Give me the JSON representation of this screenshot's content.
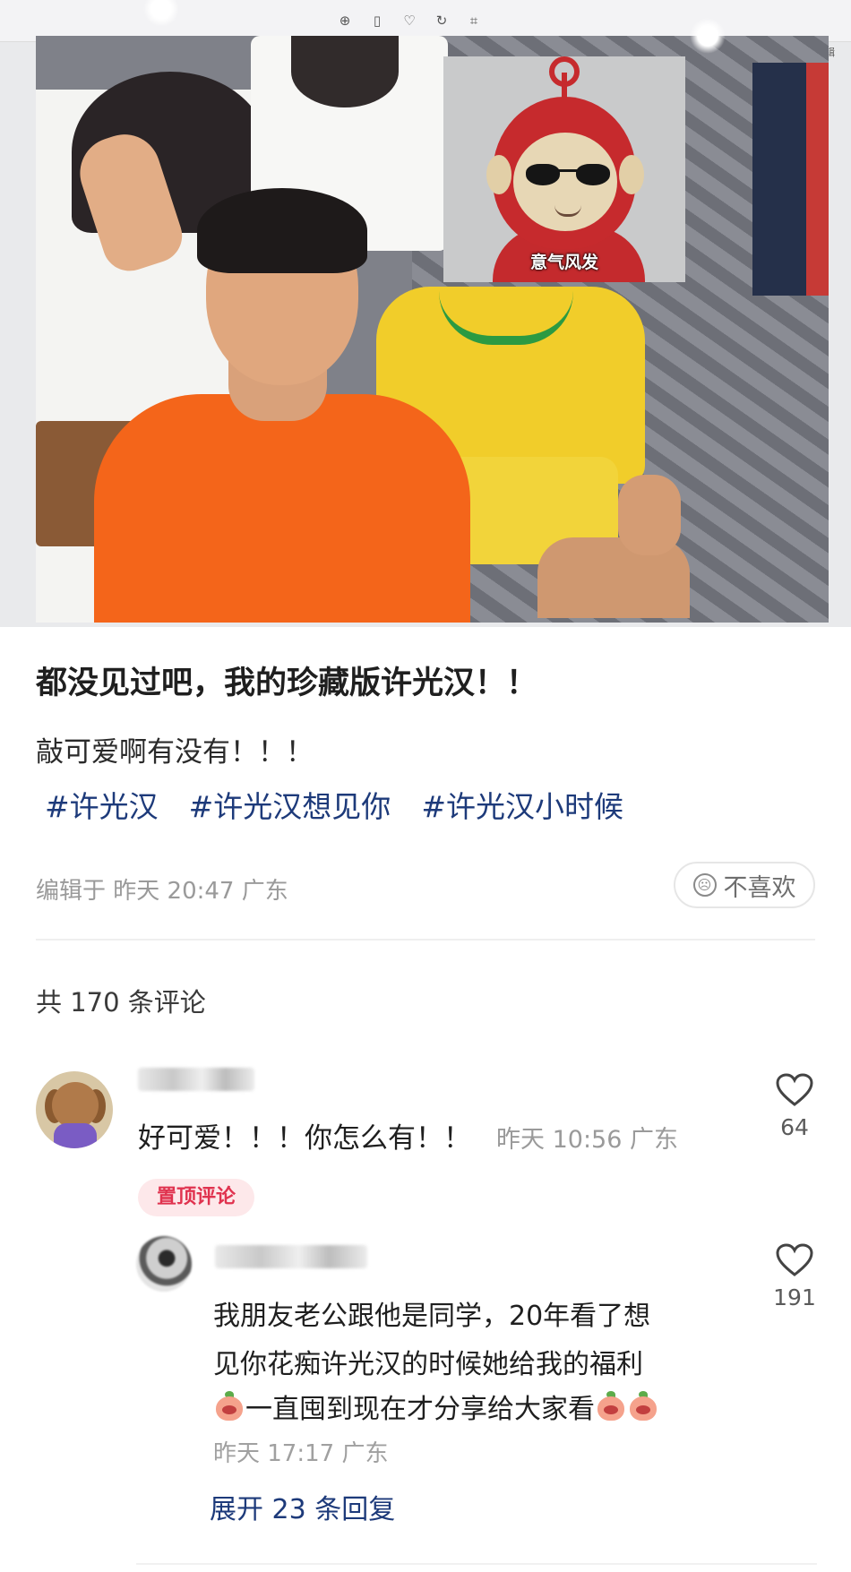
{
  "viewer": {
    "toolbar_right": [
      "搜索",
      "编辑"
    ]
  },
  "meme": {
    "caption": "意气风发"
  },
  "post": {
    "title": "都没见过吧，我的珍藏版许光汉！！",
    "body": "敲可爱啊有没有！！！",
    "hashtags": [
      "#许光汉",
      "#许光汉想见你",
      "#许光汉小时候"
    ],
    "meta": "编辑于 昨天 20:47 广东",
    "dislike_label": "不喜欢"
  },
  "comments_header": "共 170 条评论",
  "comments": [
    {
      "text": "好可爱！！！你怎么有！！",
      "time": "昨天 10:56 广东",
      "likes": "64",
      "badge": "置顶评论",
      "replies": [
        {
          "lines": [
            "我朋友老公跟他是同学，20年看了想",
            "见你花痴许光汉的时候她给我的福利",
            "一直囤到现在才分享给大家看"
          ],
          "time": "昨天 17:17 广东",
          "likes": "191"
        }
      ],
      "expand_label": "展开 23 条回复"
    }
  ],
  "colors": {
    "hashtag": "#1d3a7a",
    "pinned_badge_text": "#e0334f",
    "pinned_badge_bg": "#fde8ea",
    "meta_gray": "#9a9a9a"
  },
  "icons": [
    "zoom-icon",
    "delete-icon",
    "heart-icon",
    "rotate-icon",
    "crop-icon",
    "sad-face-icon",
    "peach-emoji-icon"
  ]
}
